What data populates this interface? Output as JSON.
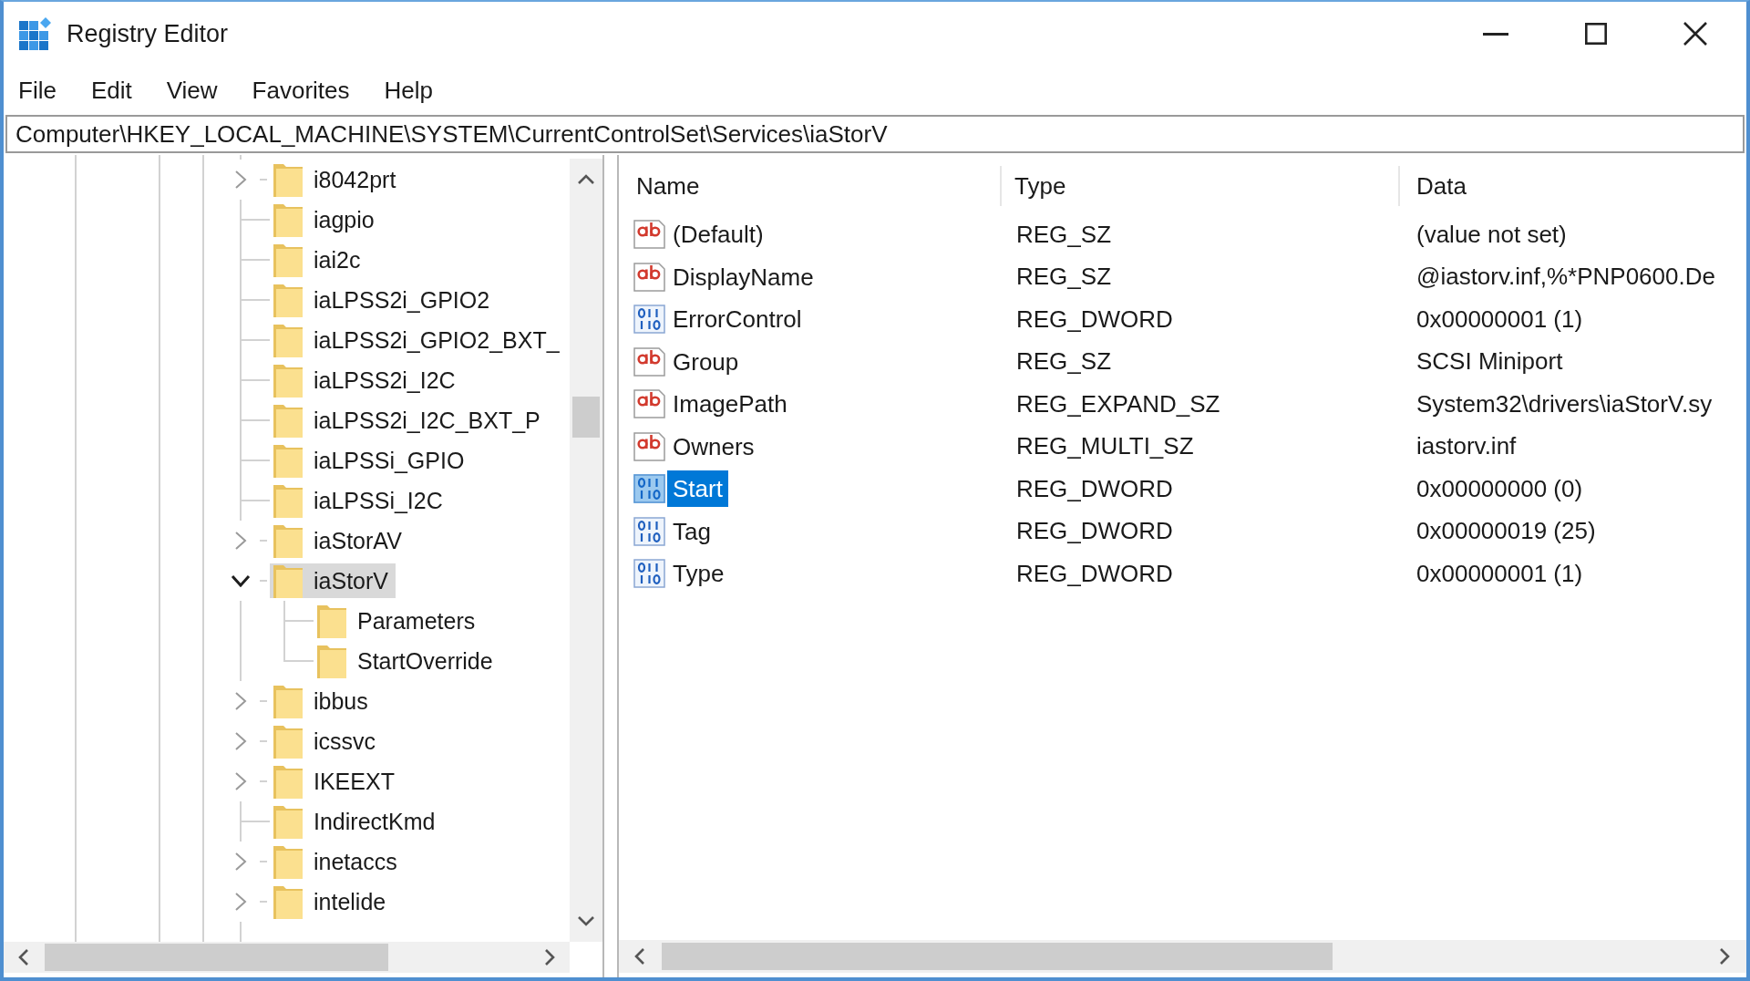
{
  "window": {
    "title": "Registry Editor"
  },
  "menu": [
    "File",
    "Edit",
    "View",
    "Favorites",
    "Help"
  ],
  "address": "Computer\\HKEY_LOCAL_MACHINE\\SYSTEM\\CurrentControlSet\\Services\\iaStorV",
  "tree": {
    "items": [
      {
        "label": "i8042prt",
        "expandable": true,
        "expanded": false,
        "selected": false
      },
      {
        "label": "iagpio",
        "expandable": false,
        "selected": false
      },
      {
        "label": "iai2c",
        "expandable": false,
        "selected": false
      },
      {
        "label": "iaLPSS2i_GPIO2",
        "expandable": false,
        "selected": false
      },
      {
        "label": "iaLPSS2i_GPIO2_BXT_",
        "expandable": false,
        "selected": false
      },
      {
        "label": "iaLPSS2i_I2C",
        "expandable": false,
        "selected": false
      },
      {
        "label": "iaLPSS2i_I2C_BXT_P",
        "expandable": false,
        "selected": false
      },
      {
        "label": "iaLPSSi_GPIO",
        "expandable": false,
        "selected": false
      },
      {
        "label": "iaLPSSi_I2C",
        "expandable": false,
        "selected": false
      },
      {
        "label": "iaStorAV",
        "expandable": true,
        "expanded": false,
        "selected": false
      },
      {
        "label": "iaStorV",
        "expandable": true,
        "expanded": true,
        "selected": true,
        "children": [
          {
            "label": "Parameters",
            "expandable": false,
            "selected": false
          },
          {
            "label": "StartOverride",
            "expandable": false,
            "selected": false
          }
        ]
      },
      {
        "label": "ibbus",
        "expandable": true,
        "expanded": false,
        "selected": false
      },
      {
        "label": "icssvc",
        "expandable": true,
        "expanded": false,
        "selected": false
      },
      {
        "label": "IKEEXT",
        "expandable": true,
        "expanded": false,
        "selected": false
      },
      {
        "label": "IndirectKmd",
        "expandable": false,
        "selected": false
      },
      {
        "label": "inetaccs",
        "expandable": true,
        "expanded": false,
        "selected": false
      },
      {
        "label": "intelide",
        "expandable": true,
        "expanded": false,
        "selected": false
      }
    ]
  },
  "values": {
    "columns": [
      "Name",
      "Type",
      "Data"
    ],
    "rows": [
      {
        "kind": "string",
        "name": "(Default)",
        "type": "REG_SZ",
        "data": "(value not set)",
        "selected": false
      },
      {
        "kind": "string",
        "name": "DisplayName",
        "type": "REG_SZ",
        "data": "@iastorv.inf,%*PNP0600.De",
        "selected": false
      },
      {
        "kind": "binary",
        "name": "ErrorControl",
        "type": "REG_DWORD",
        "data": "0x00000001 (1)",
        "selected": false
      },
      {
        "kind": "string",
        "name": "Group",
        "type": "REG_SZ",
        "data": "SCSI Miniport",
        "selected": false
      },
      {
        "kind": "string",
        "name": "ImagePath",
        "type": "REG_EXPAND_SZ",
        "data": "System32\\drivers\\iaStorV.sy",
        "selected": false
      },
      {
        "kind": "string",
        "name": "Owners",
        "type": "REG_MULTI_SZ",
        "data": "iastorv.inf",
        "selected": false
      },
      {
        "kind": "binary",
        "name": "Start",
        "type": "REG_DWORD",
        "data": "0x00000000 (0)",
        "selected": true
      },
      {
        "kind": "binary",
        "name": "Tag",
        "type": "REG_DWORD",
        "data": "0x00000019 (25)",
        "selected": false
      },
      {
        "kind": "binary",
        "name": "Type",
        "type": "REG_DWORD",
        "data": "0x00000001 (1)",
        "selected": false
      }
    ]
  }
}
